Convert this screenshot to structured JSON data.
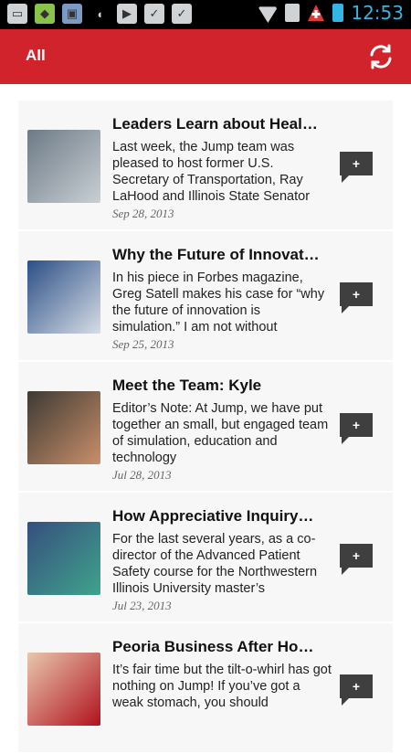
{
  "status_bar": {
    "time": "12:53",
    "icons": [
      "screenshot-icon",
      "maps-icon",
      "gallery-icon",
      "android-icon",
      "play-store-icon",
      "task-check-icon",
      "task-check-icon",
      "wifi-icon",
      "sim-icon",
      "redcross-icon",
      "battery-icon"
    ]
  },
  "app_bar": {
    "title": "All",
    "refresh_icon": "refresh-icon"
  },
  "articles": [
    {
      "title": "Leaders Learn about Healt…",
      "excerpt": "Last week, the Jump team was pleased to host former U.S. Secretary of Transportation, Ray LaHood and Illinois State Senator",
      "date": "Sep 28, 2013",
      "thumb_colors": [
        "#6d7a86",
        "#c9cfd4"
      ]
    },
    {
      "title": "Why the Future of Innovati…",
      "excerpt": "In his piece in Forbes magazine, Greg Satell makes his case for “why the future of innovation is simulation.”  I am not without",
      "date": "Sep 25, 2013",
      "thumb_colors": [
        "#2b4f86",
        "#d6dde6"
      ]
    },
    {
      "title": "Meet the Team: Kyle",
      "excerpt": "Editor’s Note: At Jump, we have put together an small, but engaged team of simulation, education and technology",
      "date": "Jul 28, 2013",
      "thumb_colors": [
        "#3d3a34",
        "#c98f6a"
      ]
    },
    {
      "title": "How Appreciative Inquiry…",
      "excerpt": "For the last several years, as a co-director of the Advanced Patient Safety course for the Northwestern Illinois University master’s",
      "date": "Jul 23, 2013",
      "thumb_colors": [
        "#364f7e",
        "#3fa38c"
      ]
    },
    {
      "title": "Peoria Business After Hour…",
      "excerpt": "It’s fair time but the tilt-o-whirl has got nothing on Jump! If you’ve got a weak stomach, you should",
      "date": "",
      "thumb_colors": [
        "#e8c7ae",
        "#b1121d"
      ]
    }
  ],
  "colors": {
    "accent": "#d0232b",
    "comment_bubble": "#3f3f3f"
  }
}
